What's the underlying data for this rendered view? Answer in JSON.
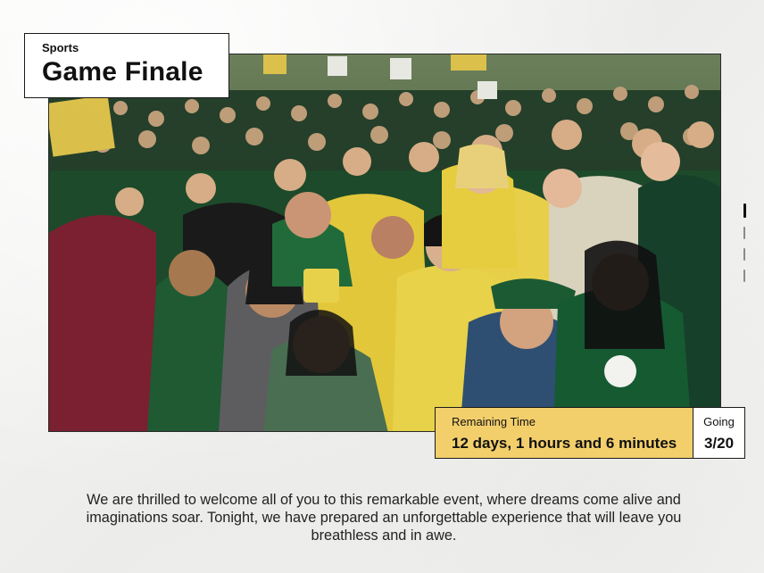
{
  "header": {
    "category": "Sports",
    "title": "Game Finale"
  },
  "photo": {
    "alt": "Crowd of cheering fans in green and yellow"
  },
  "countdown": {
    "label": "Remaining Time",
    "value": "12 days, 1 hours and 6 minutes"
  },
  "attendance": {
    "label": "Going",
    "value": "3/20"
  },
  "pager": {
    "total": 4,
    "active_index": 0
  },
  "description": "We are thrilled to welcome all of you to this remarkable event, where dreams come alive and imaginations soar. Tonight, we have prepared an unforgettable experience that will leave you breathless and in awe.",
  "colors": {
    "accent_yellow": "#f3cf6c",
    "card_white": "#ffffff",
    "border": "#1a1a1a"
  }
}
